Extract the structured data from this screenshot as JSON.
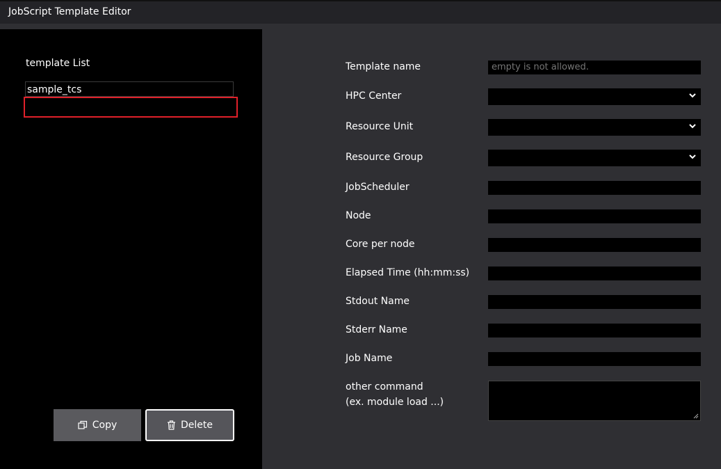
{
  "window": {
    "title": "JobScript Template Editor"
  },
  "templates": {
    "label": "template List",
    "items": [
      "sample_tcs",
      ""
    ]
  },
  "buttons": {
    "copy": "Copy",
    "delete": "Delete"
  },
  "form": {
    "template_name": {
      "label": "Template name",
      "placeholder": "empty is not allowed."
    },
    "hpc_center": {
      "label": "HPC Center",
      "value": ""
    },
    "resource_unit": {
      "label": "Resource Unit",
      "value": ""
    },
    "resource_group": {
      "label": "Resource Group",
      "value": ""
    },
    "job_scheduler": {
      "label": "JobScheduler",
      "value": ""
    },
    "node": {
      "label": "Node",
      "value": ""
    },
    "core_per_node": {
      "label": "Core per node",
      "value": ""
    },
    "elapsed_time": {
      "label": "Elapsed Time (hh:mm:ss)",
      "value": ""
    },
    "stdout_name": {
      "label": "Stdout Name",
      "value": ""
    },
    "stderr_name": {
      "label": "Stderr Name",
      "value": ""
    },
    "job_name": {
      "label": "Job Name",
      "value": ""
    },
    "other_command": {
      "label_line1": "other command",
      "label_line2": "(ex. module load ...)",
      "value": ""
    }
  },
  "icons": {
    "copy": "copy-icon",
    "delete": "trash-icon",
    "dropdown": "chevron-down-icon"
  },
  "colors": {
    "selection_border": "#e0202a",
    "panel_left": "#000000",
    "panel_right": "#2f2f33"
  }
}
